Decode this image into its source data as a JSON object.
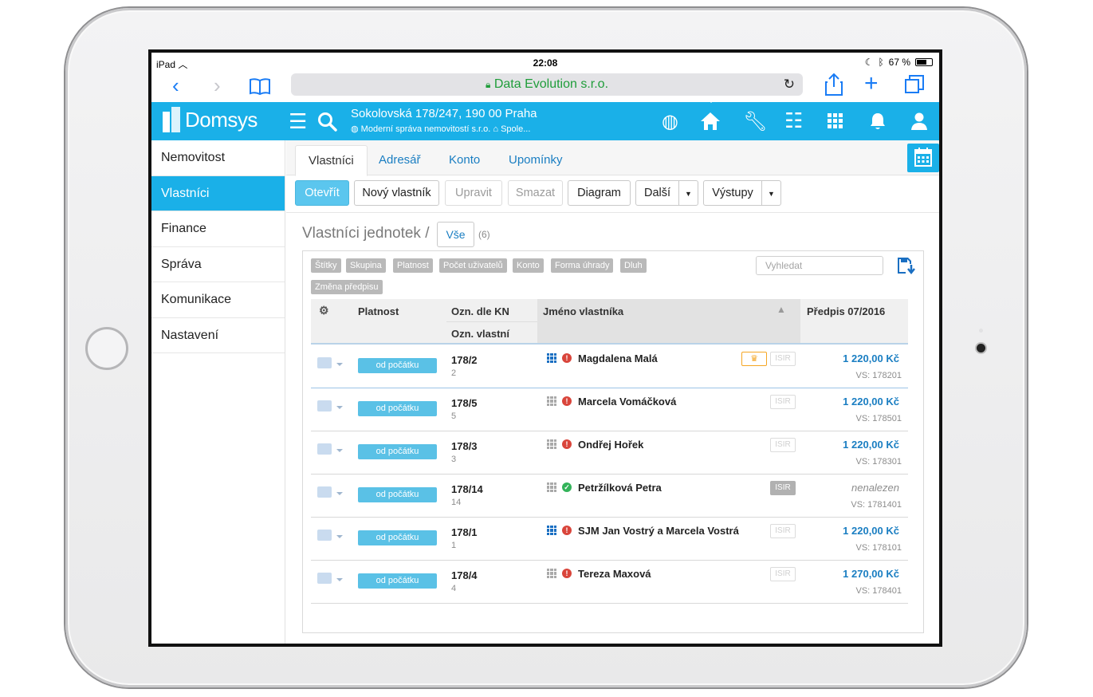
{
  "device": {
    "status_left": "iPad",
    "time": "22:08",
    "battery": "67 %"
  },
  "browser": {
    "url_title": "Data Evolution s.r.o."
  },
  "app": {
    "brand": "Domsys",
    "address_line": "Sokolovská 178/247, 190 00 Praha",
    "company": "Moderní správa nemovitostí s.r.o.",
    "company_short": "Spole..."
  },
  "sidebar": {
    "items": [
      {
        "label": "Nemovitost"
      },
      {
        "label": "Vlastníci"
      },
      {
        "label": "Finance"
      },
      {
        "label": "Správa"
      },
      {
        "label": "Komunikace"
      },
      {
        "label": "Nastavení"
      }
    ]
  },
  "tabs": [
    {
      "label": "Vlastníci"
    },
    {
      "label": "Adresář"
    },
    {
      "label": "Konto"
    },
    {
      "label": "Upomínky"
    }
  ],
  "toolbar": {
    "open": "Otevřít",
    "new_owner": "Nový vlastník",
    "edit": "Upravit",
    "delete": "Smazat",
    "diagram": "Diagram",
    "more": "Další",
    "outputs": "Výstupy"
  },
  "list": {
    "heading": "Vlastníci jednotek /",
    "filter": "Vše",
    "count": "(6)",
    "search_placeholder": "Vyhledat",
    "chips": [
      "Štítky",
      "Skupina",
      "Platnost",
      "Počet uživatelů",
      "Konto",
      "Forma úhrady",
      "Dluh",
      "Změna předpisu"
    ],
    "columns": {
      "validity": "Platnost",
      "kn": "Ozn. dle KN",
      "own": "Ozn. vlastní",
      "name": "Jméno vlastníka",
      "prescription": "Předpis 07/2016"
    },
    "rows": [
      {
        "validity": "od počátku",
        "kn": "178/2",
        "own": "2",
        "name": "Magdalena Malá",
        "amount": "1 220,00 Kč",
        "vs": "VS: 178201",
        "isir": "ISIR"
      },
      {
        "validity": "od počátku",
        "kn": "178/5",
        "own": "5",
        "name": "Marcela Vomáčková",
        "amount": "1 220,00 Kč",
        "vs": "VS: 178501",
        "isir": "ISIR"
      },
      {
        "validity": "od počátku",
        "kn": "178/3",
        "own": "3",
        "name": "Ondřej Hořek",
        "amount": "1 220,00 Kč",
        "vs": "VS: 178301",
        "isir": "ISIR"
      },
      {
        "validity": "od počátku",
        "kn": "178/14",
        "own": "14",
        "name": "Petržílková Petra",
        "amount": "nenalezen",
        "vs": "VS: 1781401",
        "isir": "ISIR"
      },
      {
        "validity": "od počátku",
        "kn": "178/1",
        "own": "1",
        "name": "SJM Jan Vostrý a Marcela Vostrá",
        "amount": "1 220,00 Kč",
        "vs": "VS: 178101",
        "isir": "ISIR"
      },
      {
        "validity": "od počátku",
        "kn": "178/4",
        "own": "4",
        "name": "Tereza Maxová",
        "amount": "1 270,00 Kč",
        "vs": "VS: 178401",
        "isir": "ISIR"
      }
    ]
  },
  "colors": {
    "accent": "#1ab0e8",
    "link": "#1a7ec2",
    "error": "#d9453b",
    "ok": "#33b35a"
  }
}
